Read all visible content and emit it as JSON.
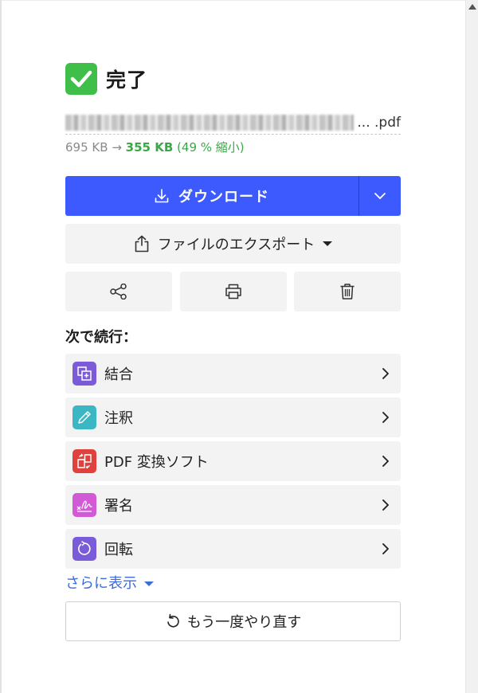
{
  "status": {
    "title": "完了"
  },
  "file": {
    "name_suffix": "... .pdf",
    "original_size": "695 KB",
    "arrow": "→",
    "new_size": "355 KB",
    "reduction": "(49 % 縮小)"
  },
  "actions": {
    "download_label": "ダウンロード",
    "export_label": "ファイルのエクスポート"
  },
  "continue": {
    "label": "次で続行：",
    "tools": [
      {
        "label": "結合",
        "icon": "merge-icon",
        "color": "#7c5bd9"
      },
      {
        "label": "注釈",
        "icon": "pencil-icon",
        "color": "#3bb7c4"
      },
      {
        "label": "PDF 変換ソフト",
        "icon": "convert-icon",
        "color": "#e0413c"
      },
      {
        "label": "署名",
        "icon": "signature-icon",
        "color": "#d25ad6"
      },
      {
        "label": "回転",
        "icon": "rotate-icon",
        "color": "#7a5bd8"
      }
    ],
    "show_more": "さらに表示"
  },
  "retry": {
    "label": "もう一度やり直す"
  },
  "colors": {
    "primary": "#3d5afe",
    "success": "#3fbf4a",
    "link": "#3d6bd8"
  }
}
